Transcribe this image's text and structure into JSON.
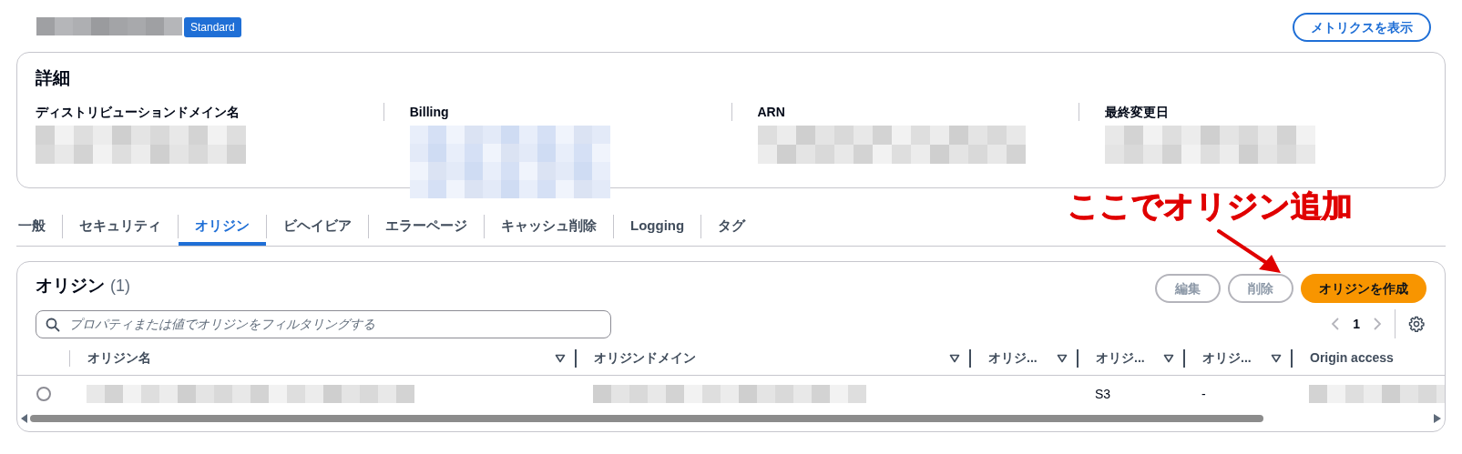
{
  "header": {
    "badge": "Standard",
    "metrics_button": "メトリクスを表示"
  },
  "details": {
    "title": "詳細",
    "fields": [
      {
        "label": "ディストリビューションドメイン名"
      },
      {
        "label": "Billing"
      },
      {
        "label": "ARN"
      },
      {
        "label": "最終変更日"
      }
    ]
  },
  "tabs": [
    {
      "label": "一般",
      "selected": false
    },
    {
      "label": "セキュリティ",
      "selected": false
    },
    {
      "label": "オリジン",
      "selected": true
    },
    {
      "label": "ビヘイビア",
      "selected": false
    },
    {
      "label": "エラーページ",
      "selected": false
    },
    {
      "label": "キャッシュ削除",
      "selected": false
    },
    {
      "label": "Logging",
      "selected": false
    },
    {
      "label": "タグ",
      "selected": false
    }
  ],
  "annotation": {
    "text": "ここでオリジン追加"
  },
  "origins": {
    "title": "オリジン",
    "count": "(1)",
    "buttons": [
      {
        "label": "編集",
        "kind": "secondary",
        "disabled": true
      },
      {
        "label": "削除",
        "kind": "secondary",
        "disabled": true
      },
      {
        "label": "オリジンを作成",
        "kind": "primary",
        "disabled": false
      }
    ],
    "search": {
      "placeholder": "プロパティまたは値でオリジンをフィルタリングする"
    },
    "pagination": {
      "page": "1"
    },
    "columns": [
      {
        "label": "オリジン名",
        "filter": true
      },
      {
        "label": "オリジンドメイン",
        "filter": true
      },
      {
        "label": "オリジ...",
        "filter": true
      },
      {
        "label": "オリジ...",
        "filter": true
      },
      {
        "label": "オリジ...",
        "filter": true
      },
      {
        "label": "Origin access",
        "filter": false
      }
    ],
    "rows": [
      {
        "selected": false,
        "cells": [
          {
            "kind": "masked"
          },
          {
            "kind": "masked"
          },
          {
            "kind": "empty"
          },
          {
            "kind": "text",
            "text": "S3"
          },
          {
            "kind": "text",
            "text": "-"
          },
          {
            "kind": "masked"
          }
        ]
      }
    ]
  }
}
